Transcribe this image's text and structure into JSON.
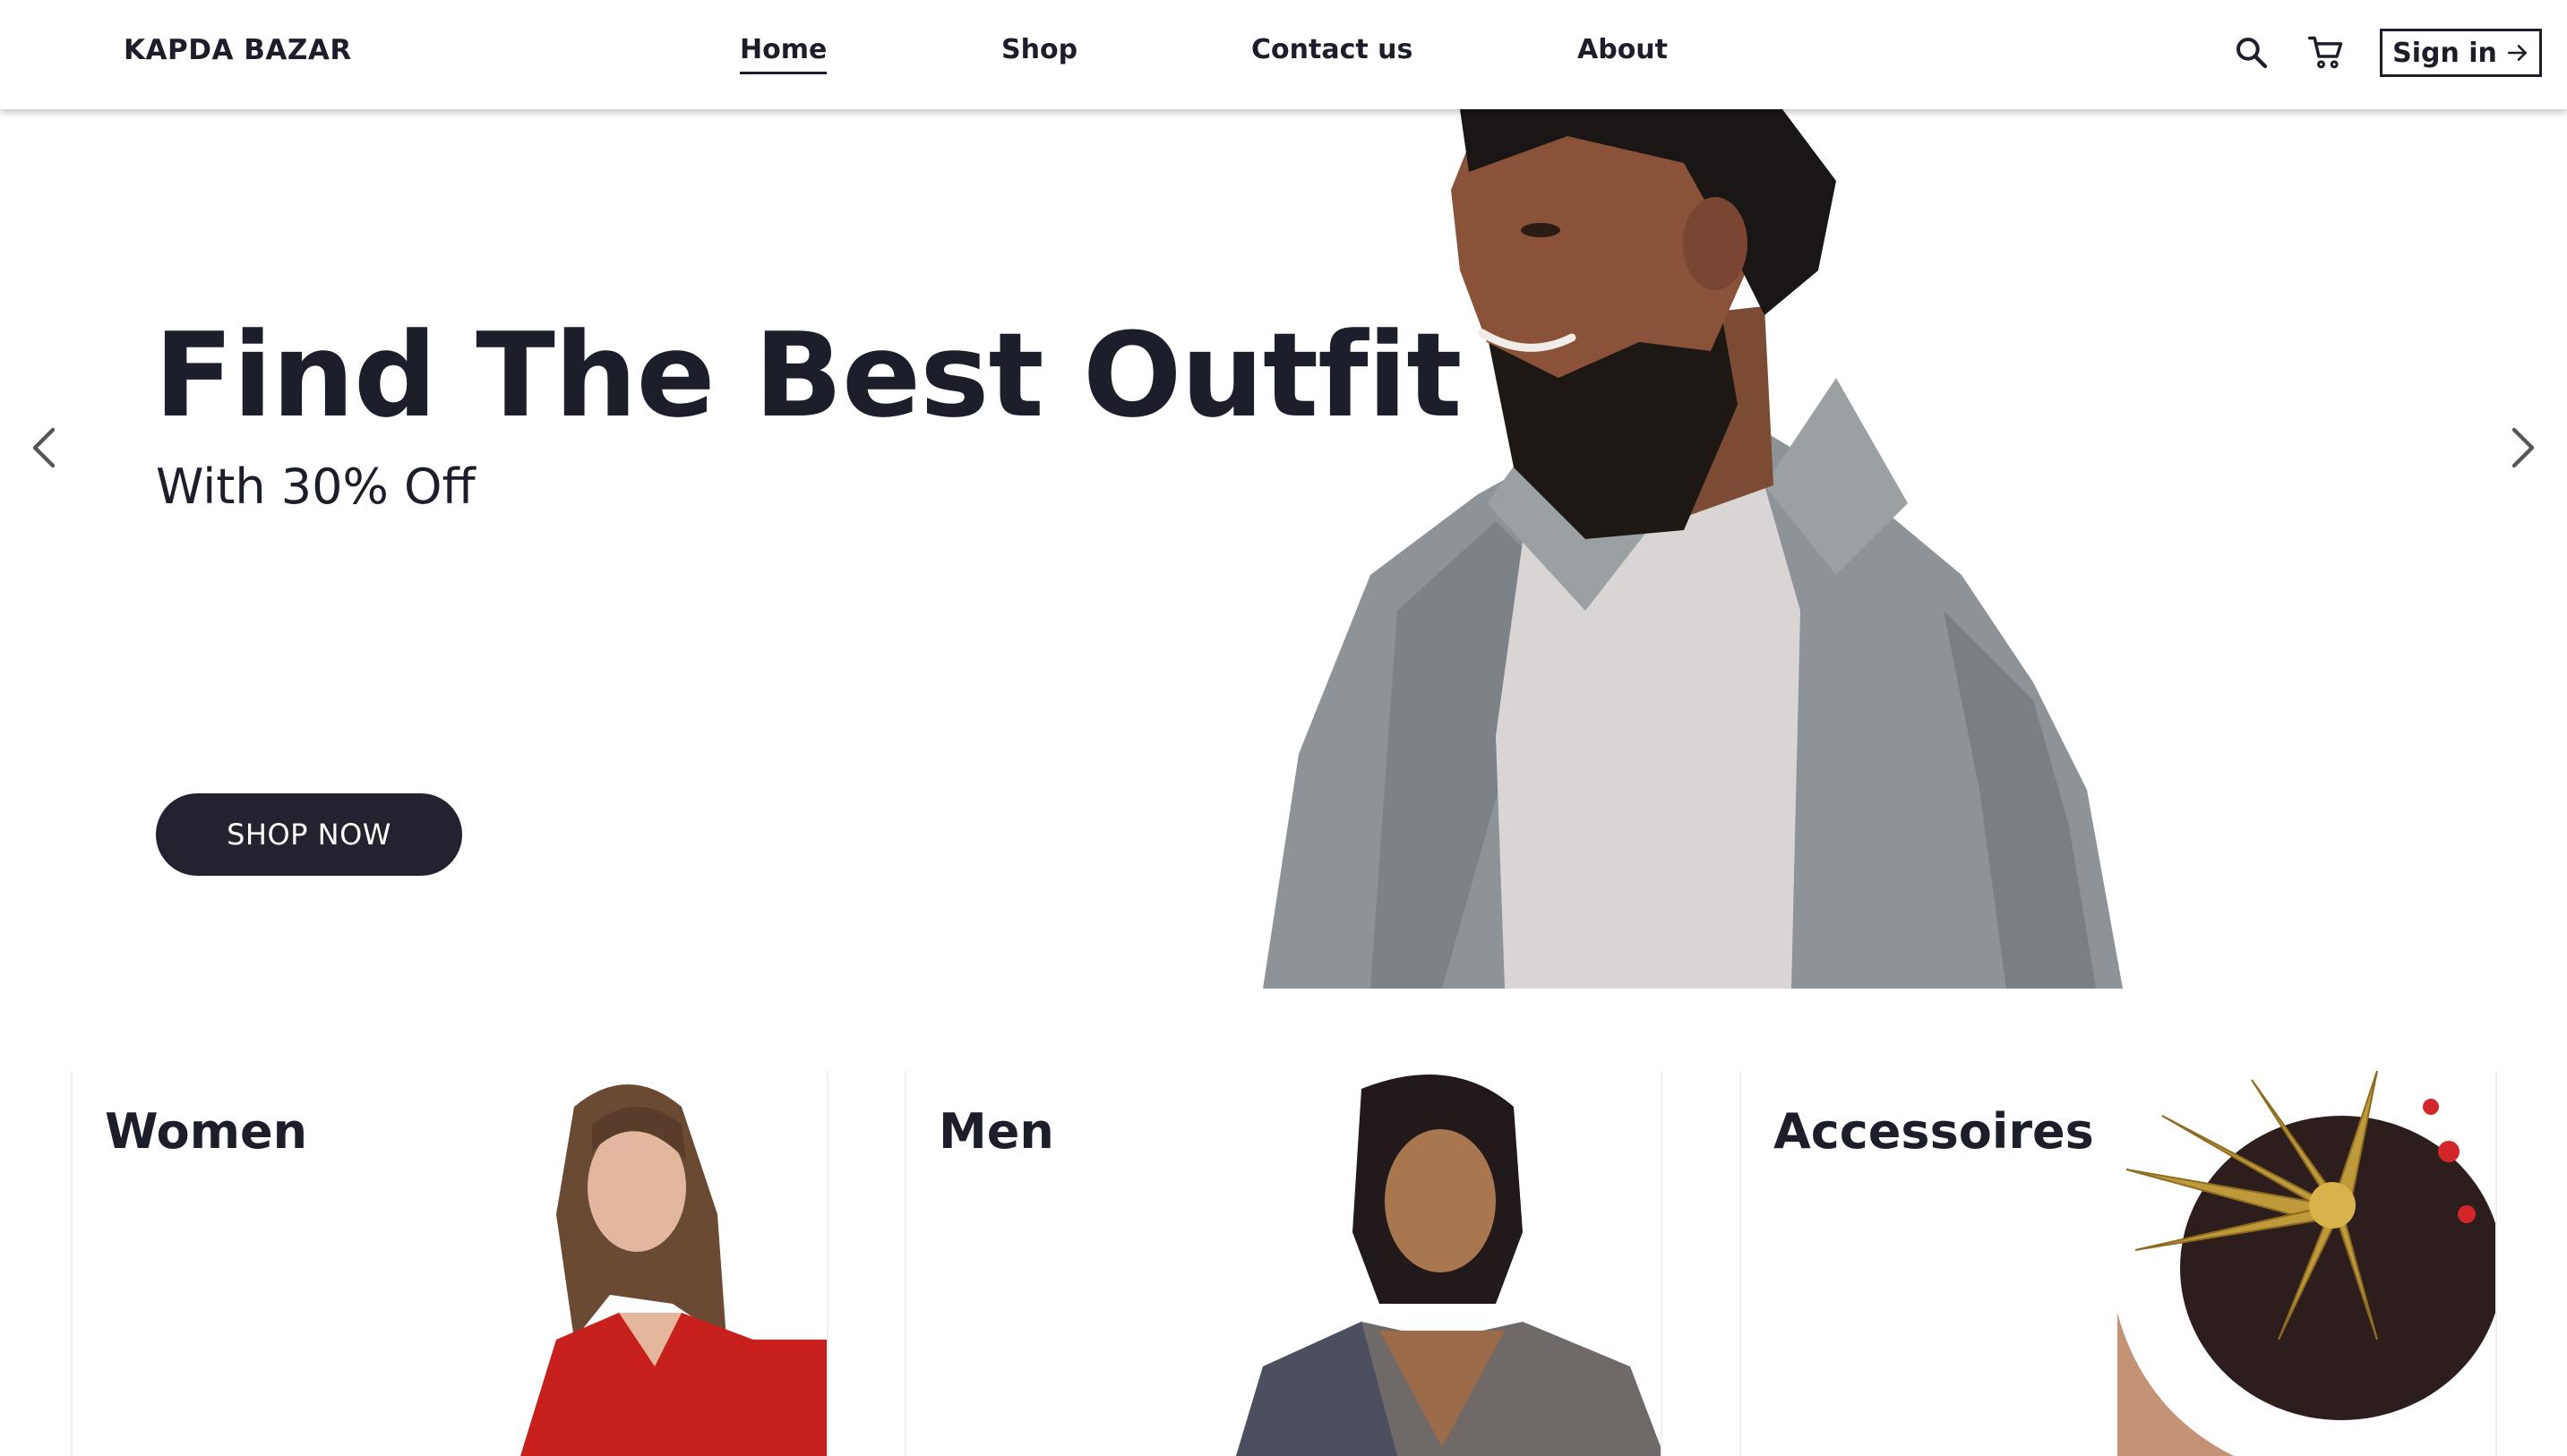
{
  "header": {
    "brand": "KAPDA BAZAR",
    "nav": {
      "home": "Home",
      "shop": "Shop",
      "contact": "Contact us",
      "about": "About"
    },
    "active_nav": "Home",
    "signin_label": "Sign in",
    "icons": [
      "search-icon",
      "cart-icon",
      "arrow-right-icon"
    ]
  },
  "hero": {
    "title": "Find The Best Outfit",
    "subtitle": "With 30% Off",
    "cta_label": "SHOP NOW"
  },
  "categories": [
    {
      "title": "Women"
    },
    {
      "title": "Men"
    },
    {
      "title": "Accessoires"
    }
  ],
  "colors": {
    "primary_dark": "#22232f",
    "text": "#1c1f2a",
    "background": "#ffffff"
  }
}
